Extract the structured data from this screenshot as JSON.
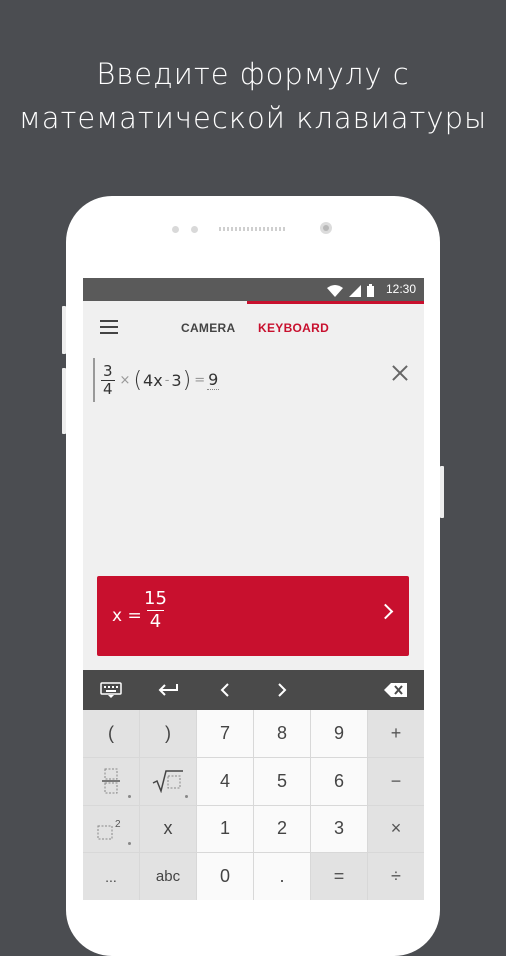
{
  "caption": {
    "line1": "Введите формулу с",
    "line2": "математической клавиатуры"
  },
  "status_bar": {
    "time": "12:30",
    "icons": [
      "wifi-icon",
      "signal-icon",
      "battery-icon"
    ]
  },
  "tabs": {
    "camera": "CAMERA",
    "keyboard": "KEYBOARD",
    "active": "keyboard"
  },
  "formula": {
    "numerator": "3",
    "denominator": "4",
    "times": "×",
    "open_paren": "(",
    "inner": "4x",
    "minus": "-",
    "inner_const": "3",
    "close_paren": ")",
    "equals": "=",
    "rhs": "9"
  },
  "result": {
    "lhs": "x =",
    "numerator": "15",
    "denominator": "4"
  },
  "keyboard": {
    "rows": [
      [
        "(",
        ")",
        "7",
        "8",
        "9",
        "+"
      ],
      [
        "fraction",
        "sqrt",
        "4",
        "5",
        "6",
        "−"
      ],
      [
        "power",
        "x",
        "1",
        "2",
        "3",
        "×"
      ],
      [
        "...",
        "abc",
        "0",
        ".",
        "=",
        "÷"
      ]
    ]
  },
  "colors": {
    "accent": "#c8102e",
    "background": "#4b4d51",
    "toolbar": "#4a4a4a"
  }
}
